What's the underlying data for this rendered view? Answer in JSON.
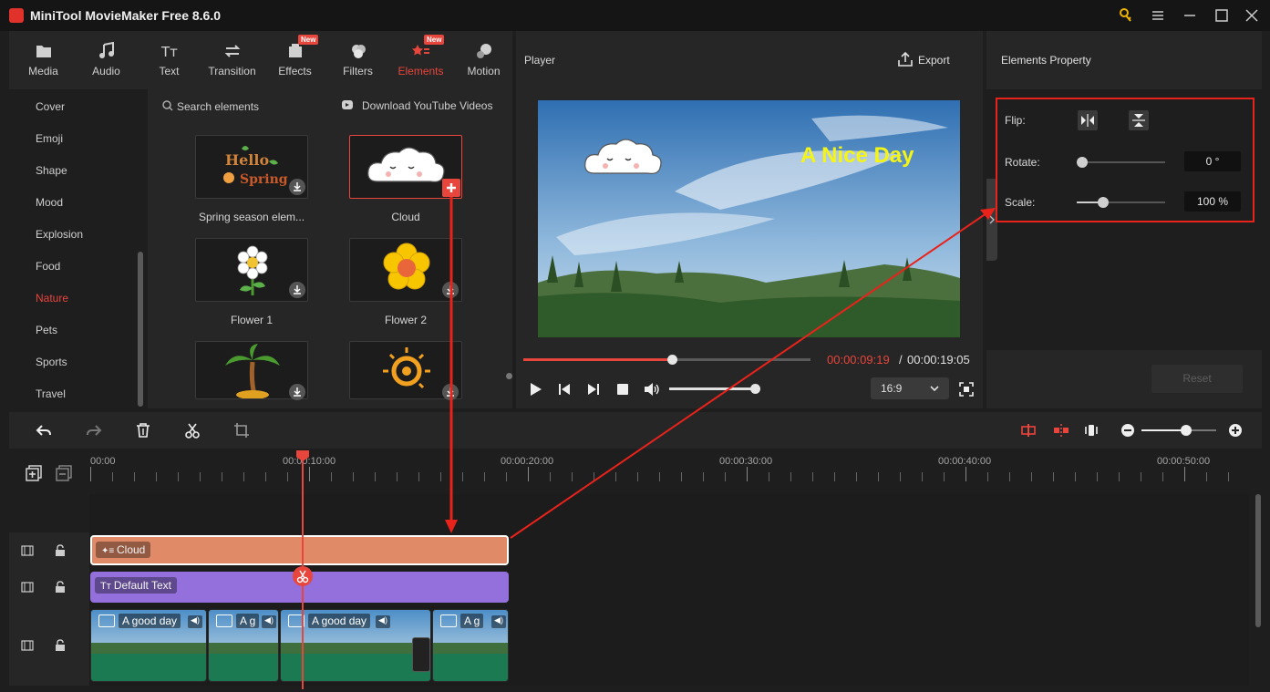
{
  "app": {
    "title": "MiniTool MovieMaker Free 8.6.0"
  },
  "nav": {
    "tabs": [
      {
        "label": "Media",
        "icon": "folder-icon"
      },
      {
        "label": "Audio",
        "icon": "music-note-icon"
      },
      {
        "label": "Text",
        "icon": "text-icon"
      },
      {
        "label": "Transition",
        "icon": "transition-arrows-icon"
      },
      {
        "label": "Effects",
        "icon": "effects-icon",
        "badge": "New"
      },
      {
        "label": "Filters",
        "icon": "filters-icon"
      },
      {
        "label": "Elements",
        "icon": "elements-icon",
        "badge": "New",
        "active": true
      },
      {
        "label": "Motion",
        "icon": "motion-icon"
      }
    ]
  },
  "categories": [
    "Cover",
    "Emoji",
    "Shape",
    "Mood",
    "Explosion",
    "Food",
    "Nature",
    "Pets",
    "Sports",
    "Travel"
  ],
  "active_category": "Nature",
  "elements": {
    "search_placeholder": "Search elements",
    "download_youtube": "Download YouTube Videos",
    "items": [
      {
        "label": "Spring season elem..."
      },
      {
        "label": "Cloud"
      },
      {
        "label": "Flower 1"
      },
      {
        "label": "Flower 2"
      },
      {
        "label": ""
      },
      {
        "label": ""
      }
    ]
  },
  "player": {
    "title": "Player",
    "export_label": "Export",
    "overlay_text": "A Nice Day",
    "current_time": "00:00:09:19",
    "separator": "/",
    "total_time": "00:00:19:05",
    "progress": 0.5,
    "volume": 0.5,
    "aspect_ratio": "16:9"
  },
  "property": {
    "title": "Elements Property",
    "flip_label": "Flip:",
    "rotate_label": "Rotate:",
    "rotate_value": "0 °",
    "rotate_level": 0.0,
    "scale_label": "Scale:",
    "scale_value": "100 %",
    "scale_level": 0.3,
    "reset_label": "Reset"
  },
  "timeline": {
    "zoom_level": 0.6,
    "ruler_labels": [
      "00:00",
      "00:00:10:00",
      "00:00:20:00",
      "00:00:30:00",
      "00:00:40:00",
      "00:00:50:00"
    ],
    "clips": {
      "element": "Cloud",
      "text": "Default Text",
      "video": [
        "A good day",
        "A g",
        "A good day",
        "A g"
      ]
    }
  },
  "colors": {
    "accent": "#e8453c",
    "element_clip": "#e08a68",
    "text_clip": "#9370db",
    "video_clip": "#1b7a52"
  }
}
